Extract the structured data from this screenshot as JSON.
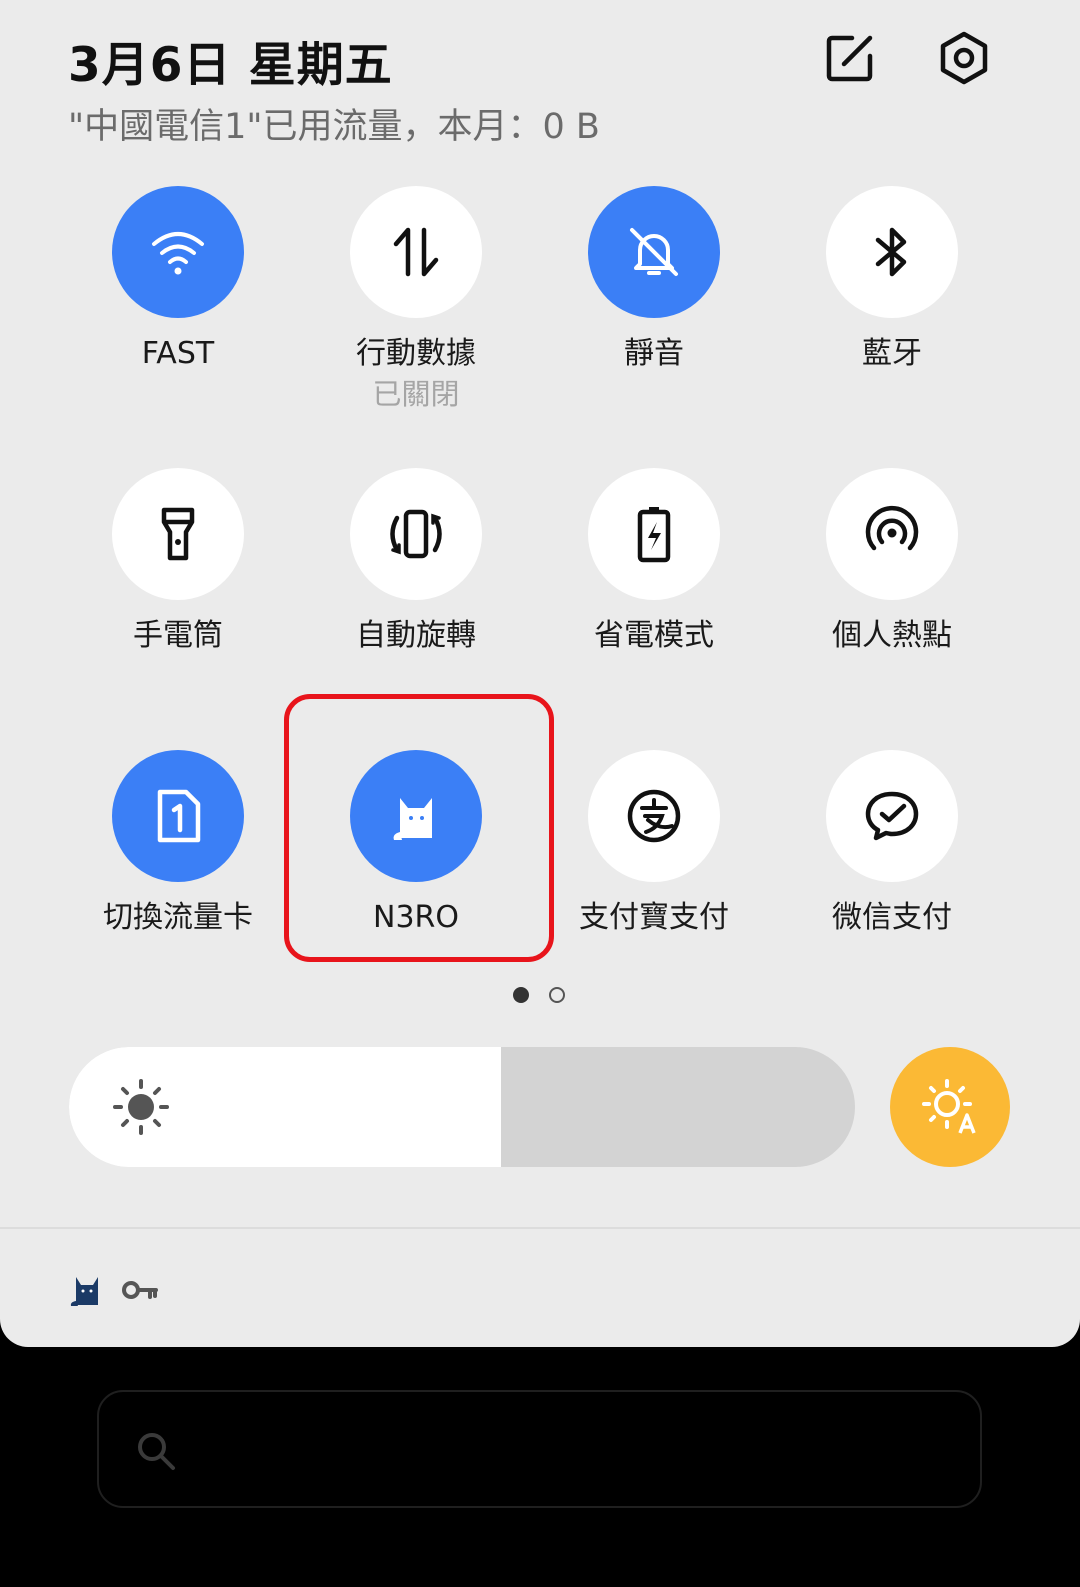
{
  "header": {
    "date": "3月6日  星期五",
    "usage": "\"中國電信1\"已用流量，本月：0 B",
    "edit_icon": "edit-icon",
    "settings_icon": "gear-icon"
  },
  "tiles": [
    {
      "label": "FAST",
      "sub": "",
      "on": true,
      "icon": "wifi-icon"
    },
    {
      "label": "行動數據",
      "sub": "已關閉",
      "on": false,
      "icon": "mobile-data-icon"
    },
    {
      "label": "靜音",
      "sub": "",
      "on": true,
      "icon": "mute-bell-icon"
    },
    {
      "label": "藍牙",
      "sub": "",
      "on": false,
      "icon": "bluetooth-icon"
    },
    {
      "label": "手電筒",
      "sub": "",
      "on": false,
      "icon": "flashlight-icon"
    },
    {
      "label": "自動旋轉",
      "sub": "",
      "on": false,
      "icon": "auto-rotate-icon"
    },
    {
      "label": "省電模式",
      "sub": "",
      "on": false,
      "icon": "battery-saver-icon"
    },
    {
      "label": "個人熱點",
      "sub": "",
      "on": false,
      "icon": "hotspot-icon"
    },
    {
      "label": "切換流量卡",
      "sub": "",
      "on": true,
      "icon": "sim-card-icon"
    },
    {
      "label": "N3RO",
      "sub": "",
      "on": true,
      "icon": "cat-icon"
    },
    {
      "label": "支付寶支付",
      "sub": "",
      "on": false,
      "icon": "alipay-icon"
    },
    {
      "label": "微信支付",
      "sub": "",
      "on": false,
      "icon": "wechat-pay-icon"
    }
  ],
  "pager": {
    "current": 1,
    "total": 2
  },
  "brightness": {
    "level": 0.55,
    "auto_icon": "auto-brightness-icon"
  },
  "status_icons": [
    "cat-icon",
    "key-icon"
  ],
  "search": {
    "icon": "search-icon"
  },
  "colors": {
    "accent": "#3b7ff6",
    "auto_brightness": "#fbb935",
    "highlight": "#e8141b"
  }
}
